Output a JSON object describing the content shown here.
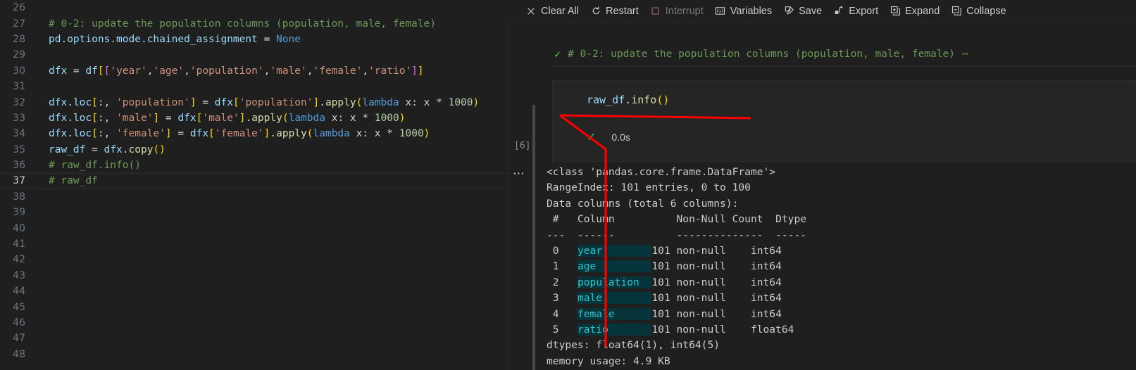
{
  "editor": {
    "first_line_number": 26,
    "active_line": 37,
    "lines": [
      {
        "n": 26,
        "tokens": []
      },
      {
        "n": 27,
        "tokens": [
          {
            "t": "com",
            "s": "# 0-2: update the population columns (population, male, female)"
          }
        ]
      },
      {
        "n": 28,
        "tokens": [
          {
            "t": "var",
            "s": "pd"
          },
          {
            "t": "plain",
            "s": "."
          },
          {
            "t": "var",
            "s": "options"
          },
          {
            "t": "plain",
            "s": "."
          },
          {
            "t": "var",
            "s": "mode"
          },
          {
            "t": "plain",
            "s": "."
          },
          {
            "t": "var",
            "s": "chained_assignment"
          },
          {
            "t": "plain",
            "s": " = "
          },
          {
            "t": "blue",
            "s": "None"
          }
        ]
      },
      {
        "n": 29,
        "tokens": []
      },
      {
        "n": 30,
        "tokens": [
          {
            "t": "var",
            "s": "dfx"
          },
          {
            "t": "plain",
            "s": " = "
          },
          {
            "t": "var",
            "s": "df"
          },
          {
            "t": "br1",
            "s": "["
          },
          {
            "t": "br2",
            "s": "["
          },
          {
            "t": "str",
            "s": "'year'"
          },
          {
            "t": "plain",
            "s": ","
          },
          {
            "t": "str",
            "s": "'age'"
          },
          {
            "t": "plain",
            "s": ","
          },
          {
            "t": "str",
            "s": "'population'"
          },
          {
            "t": "plain",
            "s": ","
          },
          {
            "t": "str",
            "s": "'male'"
          },
          {
            "t": "plain",
            "s": ","
          },
          {
            "t": "str",
            "s": "'female'"
          },
          {
            "t": "plain",
            "s": ","
          },
          {
            "t": "str",
            "s": "'ratio'"
          },
          {
            "t": "br2",
            "s": "]"
          },
          {
            "t": "br1",
            "s": "]"
          }
        ]
      },
      {
        "n": 31,
        "tokens": []
      },
      {
        "n": 32,
        "tokens": [
          {
            "t": "var",
            "s": "dfx"
          },
          {
            "t": "plain",
            "s": "."
          },
          {
            "t": "var",
            "s": "loc"
          },
          {
            "t": "br1",
            "s": "["
          },
          {
            "t": "plain",
            "s": ":, "
          },
          {
            "t": "str",
            "s": "'population'"
          },
          {
            "t": "br1",
            "s": "]"
          },
          {
            "t": "plain",
            "s": " = "
          },
          {
            "t": "var",
            "s": "dfx"
          },
          {
            "t": "br1",
            "s": "["
          },
          {
            "t": "str",
            "s": "'population'"
          },
          {
            "t": "br1",
            "s": "]"
          },
          {
            "t": "plain",
            "s": "."
          },
          {
            "t": "fn",
            "s": "apply"
          },
          {
            "t": "br1",
            "s": "("
          },
          {
            "t": "blue",
            "s": "lambda"
          },
          {
            "t": "plain",
            "s": " x: x "
          },
          {
            "t": "plain",
            "s": "* "
          },
          {
            "t": "num",
            "s": "1000"
          },
          {
            "t": "br1",
            "s": ")"
          }
        ]
      },
      {
        "n": 33,
        "tokens": [
          {
            "t": "var",
            "s": "dfx"
          },
          {
            "t": "plain",
            "s": "."
          },
          {
            "t": "var",
            "s": "loc"
          },
          {
            "t": "br1",
            "s": "["
          },
          {
            "t": "plain",
            "s": ":, "
          },
          {
            "t": "str",
            "s": "'male'"
          },
          {
            "t": "br1",
            "s": "]"
          },
          {
            "t": "plain",
            "s": " = "
          },
          {
            "t": "var",
            "s": "dfx"
          },
          {
            "t": "br1",
            "s": "["
          },
          {
            "t": "str",
            "s": "'male'"
          },
          {
            "t": "br1",
            "s": "]"
          },
          {
            "t": "plain",
            "s": "."
          },
          {
            "t": "fn",
            "s": "apply"
          },
          {
            "t": "br1",
            "s": "("
          },
          {
            "t": "blue",
            "s": "lambda"
          },
          {
            "t": "plain",
            "s": " x: x "
          },
          {
            "t": "plain",
            "s": "* "
          },
          {
            "t": "num",
            "s": "1000"
          },
          {
            "t": "br1",
            "s": ")"
          }
        ]
      },
      {
        "n": 34,
        "tokens": [
          {
            "t": "var",
            "s": "dfx"
          },
          {
            "t": "plain",
            "s": "."
          },
          {
            "t": "var",
            "s": "loc"
          },
          {
            "t": "br1",
            "s": "["
          },
          {
            "t": "plain",
            "s": ":, "
          },
          {
            "t": "str",
            "s": "'female'"
          },
          {
            "t": "br1",
            "s": "]"
          },
          {
            "t": "plain",
            "s": " = "
          },
          {
            "t": "var",
            "s": "dfx"
          },
          {
            "t": "br1",
            "s": "["
          },
          {
            "t": "str",
            "s": "'female'"
          },
          {
            "t": "br1",
            "s": "]"
          },
          {
            "t": "plain",
            "s": "."
          },
          {
            "t": "fn",
            "s": "apply"
          },
          {
            "t": "br1",
            "s": "("
          },
          {
            "t": "blue",
            "s": "lambda"
          },
          {
            "t": "plain",
            "s": " x: x "
          },
          {
            "t": "plain",
            "s": "* "
          },
          {
            "t": "num",
            "s": "1000"
          },
          {
            "t": "br1",
            "s": ")"
          }
        ]
      },
      {
        "n": 35,
        "tokens": [
          {
            "t": "var",
            "s": "raw_df"
          },
          {
            "t": "plain",
            "s": " = "
          },
          {
            "t": "var",
            "s": "dfx"
          },
          {
            "t": "plain",
            "s": "."
          },
          {
            "t": "fn",
            "s": "copy"
          },
          {
            "t": "br1",
            "s": "()"
          }
        ]
      },
      {
        "n": 36,
        "tokens": [
          {
            "t": "com",
            "s": "# raw_df.info()"
          }
        ]
      },
      {
        "n": 37,
        "tokens": [
          {
            "t": "com",
            "s": "# raw_df"
          }
        ]
      },
      {
        "n": 38,
        "tokens": []
      },
      {
        "n": 39,
        "tokens": []
      },
      {
        "n": 40,
        "tokens": []
      },
      {
        "n": 41,
        "tokens": []
      },
      {
        "n": 42,
        "tokens": []
      },
      {
        "n": 43,
        "tokens": []
      },
      {
        "n": 44,
        "tokens": []
      },
      {
        "n": 45,
        "tokens": []
      },
      {
        "n": 46,
        "tokens": []
      },
      {
        "n": 47,
        "tokens": []
      },
      {
        "n": 48,
        "tokens": []
      }
    ]
  },
  "notebook": {
    "toolbar": {
      "items": [
        {
          "label": "Clear All",
          "icon": "close-icon",
          "enabled": true
        },
        {
          "label": "Restart",
          "icon": "restart-icon",
          "enabled": true
        },
        {
          "label": "Interrupt",
          "icon": "stop-square-icon",
          "enabled": false
        },
        {
          "label": "Variables",
          "icon": "variables-icon",
          "enabled": true
        },
        {
          "label": "Save",
          "icon": "save-icon",
          "enabled": true
        },
        {
          "label": "Export",
          "icon": "export-icon",
          "enabled": true
        },
        {
          "label": "Expand",
          "icon": "expand-icon",
          "enabled": true
        },
        {
          "label": "Collapse",
          "icon": "collapse-icon",
          "enabled": true
        }
      ]
    },
    "collapsed_cell": {
      "status_glyph": "✓",
      "summary": "# 0-2: update the population columns (population, male, female)",
      "ellipsis": "⋯"
    },
    "code_cell": {
      "source_var": "raw_df",
      "source_dot": ".",
      "source_fn": "info",
      "source_parens": "()",
      "status_glyph": "✓",
      "duration": "0.0s",
      "execution_count": "[6]",
      "overflow_dots": "…"
    },
    "output": {
      "lines": [
        {
          "segs": [
            {
              "s": "<class 'pandas.core.frame.DataFrame'>"
            }
          ]
        },
        {
          "segs": [
            {
              "s": "RangeIndex: 101 entries, 0 to 100"
            }
          ]
        },
        {
          "segs": [
            {
              "s": "Data columns (total 6 columns):"
            }
          ]
        },
        {
          "segs": [
            {
              "s": " #   Column          Non-Null Count  Dtype"
            }
          ]
        },
        {
          "segs": [
            {
              "s": "---  ------          --------------  -----"
            }
          ]
        },
        {
          "segs": [
            {
              "s": " 0   "
            },
            {
              "s": "year        ",
              "hl": true
            },
            {
              "s": "101 non-null    int64"
            }
          ]
        },
        {
          "segs": [
            {
              "s": " 1   "
            },
            {
              "s": "age         ",
              "hl": true
            },
            {
              "s": "101 non-null    int64"
            }
          ]
        },
        {
          "segs": [
            {
              "s": " 2   "
            },
            {
              "s": "population  ",
              "hl": true
            },
            {
              "s": "101 non-null    int64"
            }
          ]
        },
        {
          "segs": [
            {
              "s": " 3   "
            },
            {
              "s": "male        ",
              "hl": true
            },
            {
              "s": "101 non-null    int64"
            }
          ]
        },
        {
          "segs": [
            {
              "s": " 4   "
            },
            {
              "s": "female      ",
              "hl": true
            },
            {
              "s": "101 non-null    int64"
            }
          ]
        },
        {
          "segs": [
            {
              "s": " 5   "
            },
            {
              "s": "ratio       ",
              "hl": true
            },
            {
              "s": "101 non-null    float64"
            }
          ]
        },
        {
          "segs": [
            {
              "s": "dtypes: float64(1), int64(5)"
            }
          ]
        },
        {
          "segs": [
            {
              "s": "memory usage: 4.9 KB"
            }
          ]
        }
      ]
    }
  },
  "annotation": {
    "color": "#ff0000",
    "shapes": "arrow from minimap to raw_df.info() underline and down the output block"
  },
  "colors": {
    "background": "#1f1f1f",
    "cell_background": "#252526",
    "comment_green": "#6A9955",
    "string_orange": "#CE9178",
    "variable_blue": "#9CDCFE",
    "keyword_blue": "#569CD6",
    "function_yellow": "#DCDCAA",
    "number_green": "#B5CEA8",
    "output_highlight_bg": "#05353b",
    "output_highlight_fg": "#2ec4cf",
    "annotation_red": "#ff0000"
  }
}
